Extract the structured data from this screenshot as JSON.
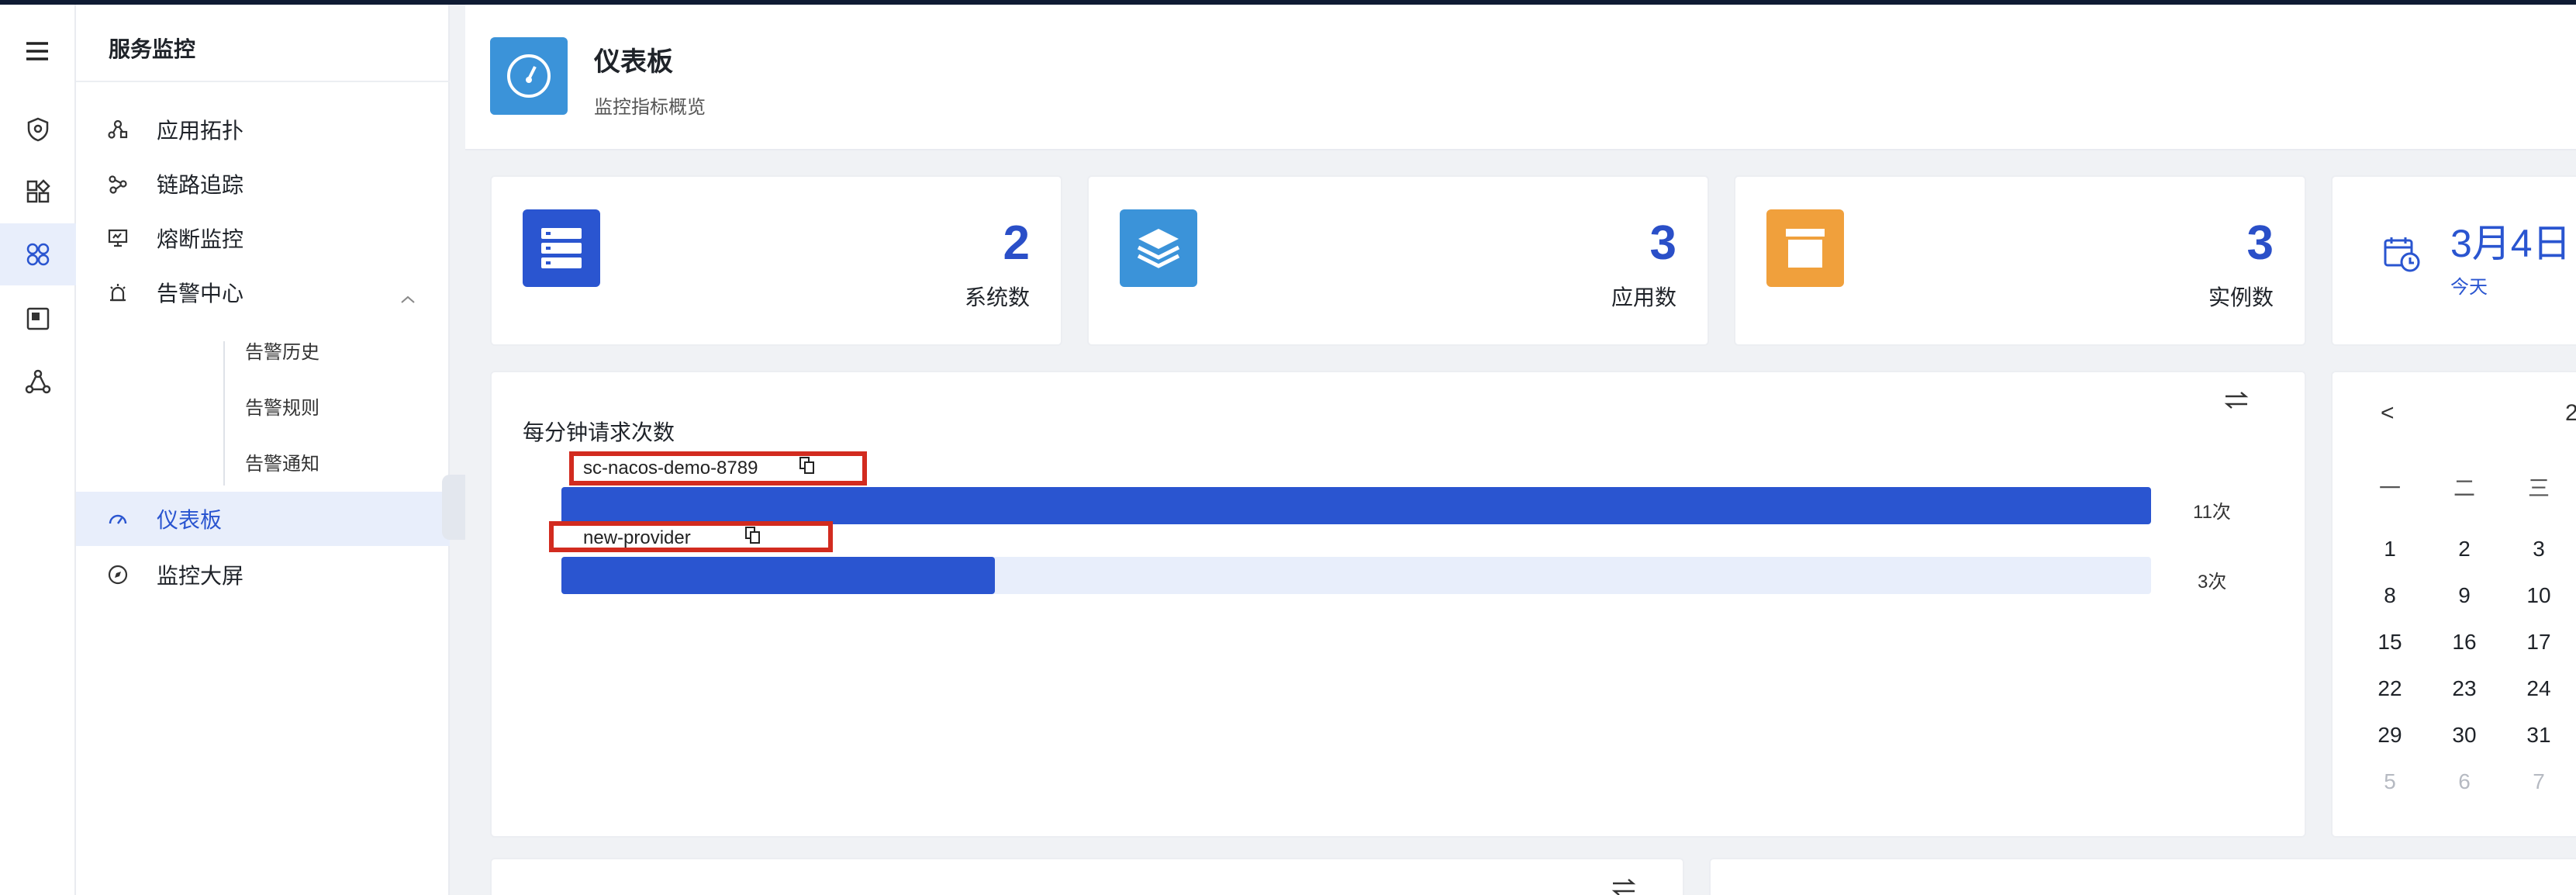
{
  "sidebar": {
    "title": "服务监控",
    "items": [
      {
        "label": "应用拓扑",
        "icon": "topology-icon"
      },
      {
        "label": "链路追踪",
        "icon": "trace-icon"
      },
      {
        "label": "熔断监控",
        "icon": "monitor-icon"
      },
      {
        "label": "告警中心",
        "icon": "alarm-icon"
      },
      {
        "label": "仪表板",
        "icon": "dashboard-gauge-icon"
      },
      {
        "label": "监控大屏",
        "icon": "compass-icon"
      }
    ],
    "alarm_children": [
      "告警历史",
      "告警规则",
      "告警通知"
    ]
  },
  "header": {
    "title": "仪表板",
    "subtitle": "监控指标概览"
  },
  "stats": [
    {
      "value": "2",
      "label": "系统数",
      "icon": "server-list-icon",
      "color": "#2a55d0"
    },
    {
      "value": "3",
      "label": "应用数",
      "icon": "layers-icon",
      "color": "#3b93d9"
    },
    {
      "value": "3",
      "label": "实例数",
      "icon": "box-icon",
      "color": "#f0a03c"
    }
  ],
  "today": {
    "date": "3月4日",
    "label": "今天"
  },
  "requests_chart": {
    "title": "每分钟请求次数",
    "chart_data": {
      "type": "bar",
      "orientation": "horizontal",
      "categories": [
        "sc-nacos-demo-8789",
        "new-provider"
      ],
      "values": [
        11,
        3
      ],
      "value_labels": [
        "11次",
        "3次"
      ],
      "xlim": [
        0,
        11
      ]
    }
  },
  "calendar": {
    "nav_prev": "<",
    "year_partial": "2",
    "weekdays": [
      "一",
      "二",
      "三"
    ],
    "rows": [
      [
        "1",
        "2",
        "3"
      ],
      [
        "8",
        "9",
        "10"
      ],
      [
        "15",
        "16",
        "17"
      ],
      [
        "22",
        "23",
        "24"
      ],
      [
        "29",
        "30",
        "31"
      ],
      [
        "5",
        "6",
        "7"
      ]
    ]
  },
  "colors": {
    "accent": "#2a55d0",
    "highlight": "#d22b1f",
    "track": "#e8eefb"
  }
}
